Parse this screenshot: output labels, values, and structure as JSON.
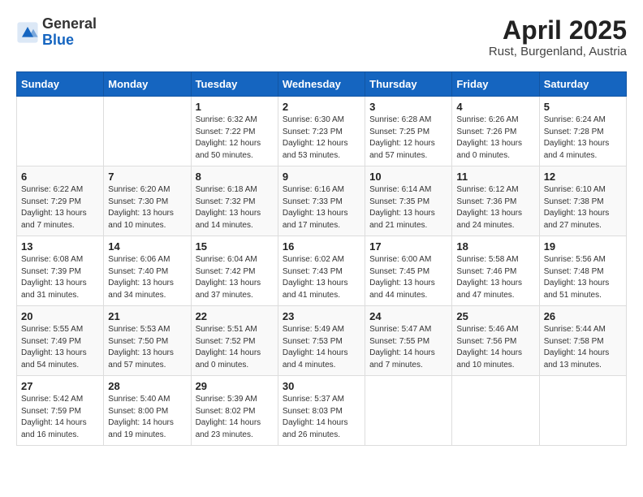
{
  "header": {
    "logo_general": "General",
    "logo_blue": "Blue",
    "month": "April 2025",
    "location": "Rust, Burgenland, Austria"
  },
  "weekdays": [
    "Sunday",
    "Monday",
    "Tuesday",
    "Wednesday",
    "Thursday",
    "Friday",
    "Saturday"
  ],
  "weeks": [
    [
      null,
      null,
      {
        "day": 1,
        "sunrise": "6:32 AM",
        "sunset": "7:22 PM",
        "daylight": "12 hours and 50 minutes."
      },
      {
        "day": 2,
        "sunrise": "6:30 AM",
        "sunset": "7:23 PM",
        "daylight": "12 hours and 53 minutes."
      },
      {
        "day": 3,
        "sunrise": "6:28 AM",
        "sunset": "7:25 PM",
        "daylight": "12 hours and 57 minutes."
      },
      {
        "day": 4,
        "sunrise": "6:26 AM",
        "sunset": "7:26 PM",
        "daylight": "13 hours and 0 minutes."
      },
      {
        "day": 5,
        "sunrise": "6:24 AM",
        "sunset": "7:28 PM",
        "daylight": "13 hours and 4 minutes."
      }
    ],
    [
      {
        "day": 6,
        "sunrise": "6:22 AM",
        "sunset": "7:29 PM",
        "daylight": "13 hours and 7 minutes."
      },
      {
        "day": 7,
        "sunrise": "6:20 AM",
        "sunset": "7:30 PM",
        "daylight": "13 hours and 10 minutes."
      },
      {
        "day": 8,
        "sunrise": "6:18 AM",
        "sunset": "7:32 PM",
        "daylight": "13 hours and 14 minutes."
      },
      {
        "day": 9,
        "sunrise": "6:16 AM",
        "sunset": "7:33 PM",
        "daylight": "13 hours and 17 minutes."
      },
      {
        "day": 10,
        "sunrise": "6:14 AM",
        "sunset": "7:35 PM",
        "daylight": "13 hours and 21 minutes."
      },
      {
        "day": 11,
        "sunrise": "6:12 AM",
        "sunset": "7:36 PM",
        "daylight": "13 hours and 24 minutes."
      },
      {
        "day": 12,
        "sunrise": "6:10 AM",
        "sunset": "7:38 PM",
        "daylight": "13 hours and 27 minutes."
      }
    ],
    [
      {
        "day": 13,
        "sunrise": "6:08 AM",
        "sunset": "7:39 PM",
        "daylight": "13 hours and 31 minutes."
      },
      {
        "day": 14,
        "sunrise": "6:06 AM",
        "sunset": "7:40 PM",
        "daylight": "13 hours and 34 minutes."
      },
      {
        "day": 15,
        "sunrise": "6:04 AM",
        "sunset": "7:42 PM",
        "daylight": "13 hours and 37 minutes."
      },
      {
        "day": 16,
        "sunrise": "6:02 AM",
        "sunset": "7:43 PM",
        "daylight": "13 hours and 41 minutes."
      },
      {
        "day": 17,
        "sunrise": "6:00 AM",
        "sunset": "7:45 PM",
        "daylight": "13 hours and 44 minutes."
      },
      {
        "day": 18,
        "sunrise": "5:58 AM",
        "sunset": "7:46 PM",
        "daylight": "13 hours and 47 minutes."
      },
      {
        "day": 19,
        "sunrise": "5:56 AM",
        "sunset": "7:48 PM",
        "daylight": "13 hours and 51 minutes."
      }
    ],
    [
      {
        "day": 20,
        "sunrise": "5:55 AM",
        "sunset": "7:49 PM",
        "daylight": "13 hours and 54 minutes."
      },
      {
        "day": 21,
        "sunrise": "5:53 AM",
        "sunset": "7:50 PM",
        "daylight": "13 hours and 57 minutes."
      },
      {
        "day": 22,
        "sunrise": "5:51 AM",
        "sunset": "7:52 PM",
        "daylight": "14 hours and 0 minutes."
      },
      {
        "day": 23,
        "sunrise": "5:49 AM",
        "sunset": "7:53 PM",
        "daylight": "14 hours and 4 minutes."
      },
      {
        "day": 24,
        "sunrise": "5:47 AM",
        "sunset": "7:55 PM",
        "daylight": "14 hours and 7 minutes."
      },
      {
        "day": 25,
        "sunrise": "5:46 AM",
        "sunset": "7:56 PM",
        "daylight": "14 hours and 10 minutes."
      },
      {
        "day": 26,
        "sunrise": "5:44 AM",
        "sunset": "7:58 PM",
        "daylight": "14 hours and 13 minutes."
      }
    ],
    [
      {
        "day": 27,
        "sunrise": "5:42 AM",
        "sunset": "7:59 PM",
        "daylight": "14 hours and 16 minutes."
      },
      {
        "day": 28,
        "sunrise": "5:40 AM",
        "sunset": "8:00 PM",
        "daylight": "14 hours and 19 minutes."
      },
      {
        "day": 29,
        "sunrise": "5:39 AM",
        "sunset": "8:02 PM",
        "daylight": "14 hours and 23 minutes."
      },
      {
        "day": 30,
        "sunrise": "5:37 AM",
        "sunset": "8:03 PM",
        "daylight": "14 hours and 26 minutes."
      },
      null,
      null,
      null
    ]
  ]
}
